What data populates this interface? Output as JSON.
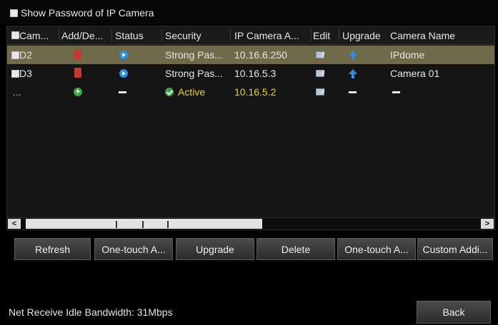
{
  "show_password": {
    "label": "Show Password of IP Camera"
  },
  "table": {
    "headers": [
      "Cam...",
      "Add/De...",
      "Status",
      "Security",
      "IP Camera A...",
      "Edit",
      "Upgrade",
      "Camera Name"
    ],
    "rows": [
      {
        "camera": "D2",
        "security": "Strong Pas...",
        "ip": "10.16.6.250",
        "name": "IPdome"
      },
      {
        "camera": "D3",
        "security": "Strong Pas...",
        "ip": "10.16.5.3",
        "name": "Camera 01"
      },
      {
        "camera": "...",
        "security": "Active",
        "ip": "10.16.5.2",
        "name": ""
      }
    ]
  },
  "scrollbar": {
    "left_arrow": "<",
    "right_arrow": ">"
  },
  "buttons": {
    "refresh": "Refresh",
    "one_touch_adding": "One-touch A...",
    "upgrade": "Upgrade",
    "delete": "Delete",
    "one_touch_activation": "One-touch A...",
    "custom_adding": "Custom Addi..."
  },
  "footer": {
    "bandwidth": "Net Receive Idle Bandwidth: 31Mbps",
    "back": "Back"
  },
  "colors": {
    "selected_row": "#6f6a4a",
    "active_text": "#e6d22e",
    "delete_icon": "#c23b32",
    "play_icon": "#2f8de6"
  }
}
